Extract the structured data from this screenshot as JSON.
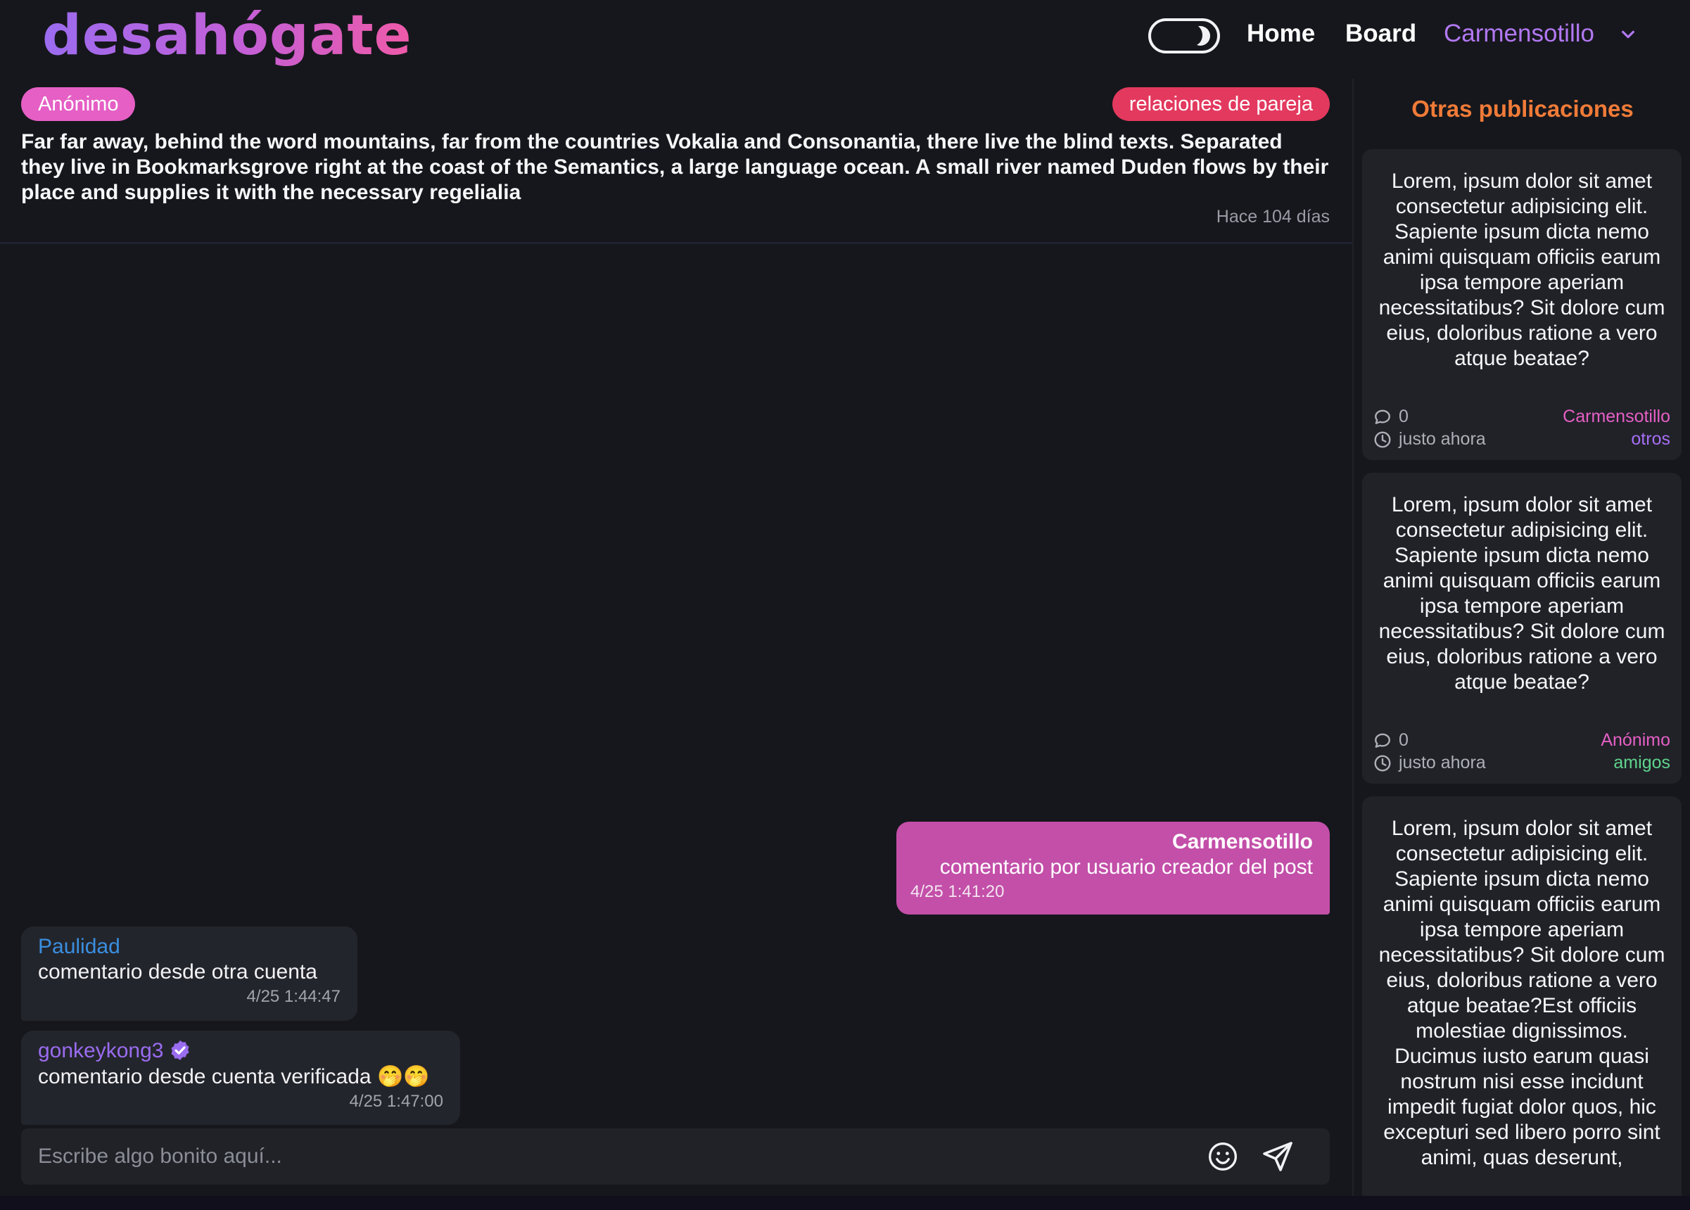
{
  "header": {
    "logo": "desahógate",
    "nav": {
      "home": "Home",
      "board": "Board",
      "user": "Carmensotillo"
    }
  },
  "post": {
    "author": "Anónimo",
    "category": "relaciones de pareja",
    "body": "Far far away, behind the word mountains, far from the countries Vokalia and Consonantia, there live the blind texts. Separated they live in Bookmarksgrove right at the coast of the Semantics, a large language ocean. A small river named Duden flows by their place and supplies it with the necessary regelialia",
    "time": "Hace 104 días"
  },
  "comments": [
    {
      "author": "Carmensotillo",
      "text": "comentario por usuario creador del post",
      "time": "4/25 1:41:20"
    },
    {
      "author": "Paulidad",
      "text": "comentario desde otra cuenta",
      "time": "4/25 1:44:47"
    },
    {
      "author": "gonkeykong3",
      "text": "comentario desde cuenta verificada 🤭🤭",
      "time": "4/25 1:47:00",
      "verified": true
    }
  ],
  "composer": {
    "placeholder": "Escribe algo bonito aquí..."
  },
  "sidebar": {
    "title": "Otras publicaciones",
    "cards": [
      {
        "text": "Lorem, ipsum dolor sit amet consectetur adipisicing elit. Sapiente ipsum dicta nemo animi quisquam officiis earum ipsa tempore aperiam necessitatibus? Sit dolore cum eius, doloribus ratione a vero atque beatae?",
        "comments": "0",
        "time": "justo ahora",
        "author": "Carmensotillo",
        "category": "otros"
      },
      {
        "text": "Lorem, ipsum dolor sit amet consectetur adipisicing elit. Sapiente ipsum dicta nemo animi quisquam officiis earum ipsa tempore aperiam necessitatibus? Sit dolore cum eius, doloribus ratione a vero atque beatae?",
        "comments": "0",
        "time": "justo ahora",
        "author": "Anónimo",
        "category": "amigos"
      },
      {
        "text": "Lorem, ipsum dolor sit amet consectetur adipisicing elit. Sapiente ipsum dicta nemo animi quisquam officiis earum ipsa tempore aperiam necessitatibus? Sit dolore cum eius, doloribus ratione a vero atque beatae?Est officiis molestiae dignissimos. Ducimus iusto earum quasi nostrum nisi esse incidunt impedit fugiat dolor quos, hic excepturi sed libero porro sint animi, quas deserunt,"
      }
    ]
  },
  "icons": {
    "theme_toggle": "moon-icon",
    "dropdown": "chevron-down-icon",
    "verified": "verified-badge-icon",
    "emoji": "smiley-icon",
    "send": "send-icon",
    "comments": "comment-icon",
    "time": "clock-icon"
  },
  "colors": {
    "background": "#16171c",
    "accent_pink": "#e55fc5",
    "accent_purple": "#a76ef5",
    "category_red": "#e3395f",
    "sidebar_title": "#f07b38",
    "own_bubble": "#c34fa9"
  }
}
